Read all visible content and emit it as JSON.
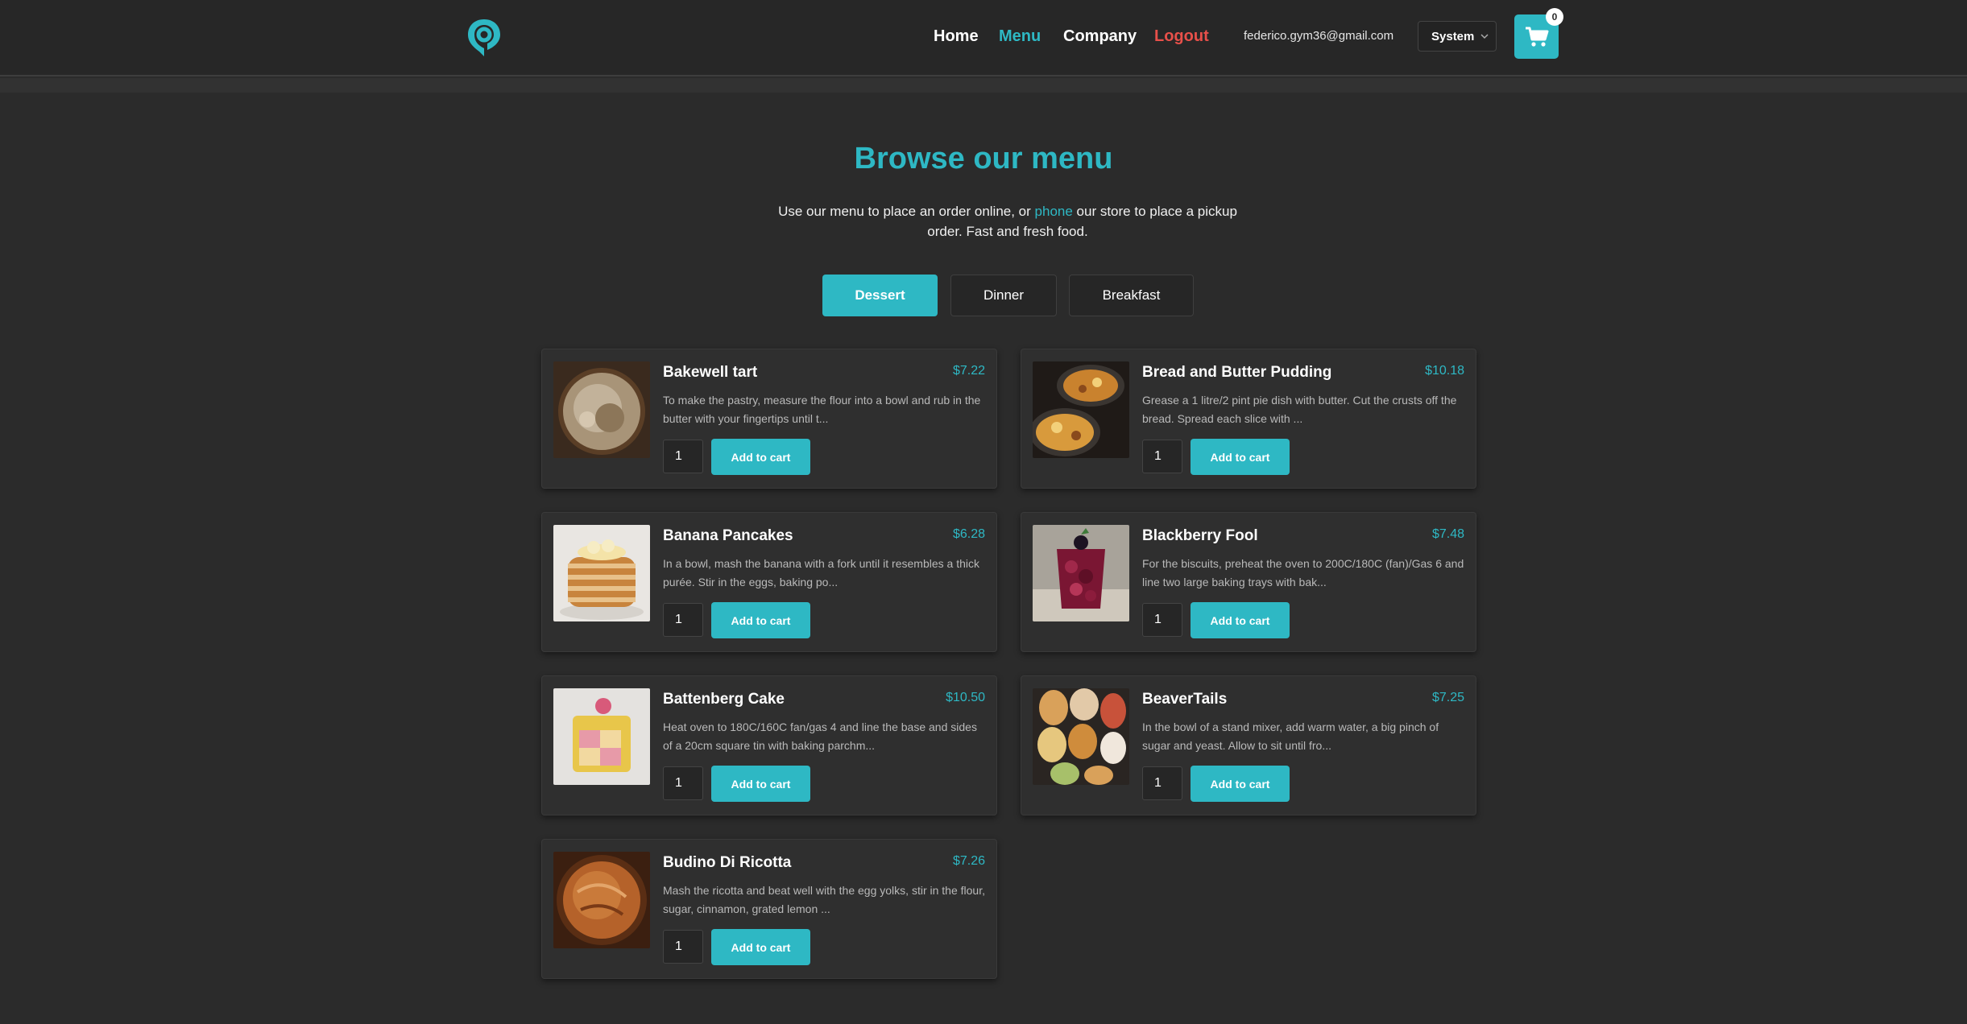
{
  "brand": {
    "accent": "#2eb8c4",
    "logo_icon": "location-pin-logo-icon"
  },
  "nav": {
    "home": "Home",
    "menu": "Menu",
    "company": "Company",
    "logout": "Logout",
    "active_color": "#2eb8c4",
    "logout_color": "#e8504a"
  },
  "user": {
    "email": "federico.gym36@gmail.com"
  },
  "theme_select": {
    "value": "System"
  },
  "cart": {
    "count": "0",
    "icon": "cart-icon"
  },
  "hero": {
    "title": "Browse our menu",
    "text_before": "Use our menu to place an order online, or ",
    "text_link": "phone",
    "text_after": " our store to place a pickup order. Fast and fresh food."
  },
  "tabs": [
    {
      "label": "Dessert",
      "active": true
    },
    {
      "label": "Dinner",
      "active": false
    },
    {
      "label": "Breakfast",
      "active": false
    }
  ],
  "add_label": "Add to cart",
  "items": [
    {
      "name": "Bakewell tart",
      "price": "$7.22",
      "qty": "1",
      "desc": "To make the pastry, measure the flour into a bowl and rub in the butter with your fingertips until t..."
    },
    {
      "name": "Bread and Butter Pudding",
      "price": "$10.18",
      "qty": "1",
      "desc": "Grease a 1 litre/2 pint pie dish with butter. Cut the crusts off the bread. Spread each slice with ..."
    },
    {
      "name": "Banana Pancakes",
      "price": "$6.28",
      "qty": "1",
      "desc": "In a bowl, mash the banana with a fork until it resembles a thick purée. Stir in the eggs, baking po..."
    },
    {
      "name": "Blackberry Fool",
      "price": "$7.48",
      "qty": "1",
      "desc": "For the biscuits, preheat the oven to 200C/180C (fan)/Gas 6 and line two large baking trays with bak..."
    },
    {
      "name": "Battenberg Cake",
      "price": "$10.50",
      "qty": "1",
      "desc": "Heat oven to 180C/160C fan/gas 4 and line the base and sides of a 20cm square tin with baking parchm..."
    },
    {
      "name": "BeaverTails",
      "price": "$7.25",
      "qty": "1",
      "desc": "In the bowl of a stand mixer, add warm water, a big pinch of sugar and yeast. Allow to sit until fro..."
    },
    {
      "name": "Budino Di Ricotta",
      "price": "$7.26",
      "qty": "1",
      "desc": "Mash the ricotta and beat well with the egg yolks, stir in the flour, sugar, cinnamon, grated lemon ..."
    }
  ]
}
